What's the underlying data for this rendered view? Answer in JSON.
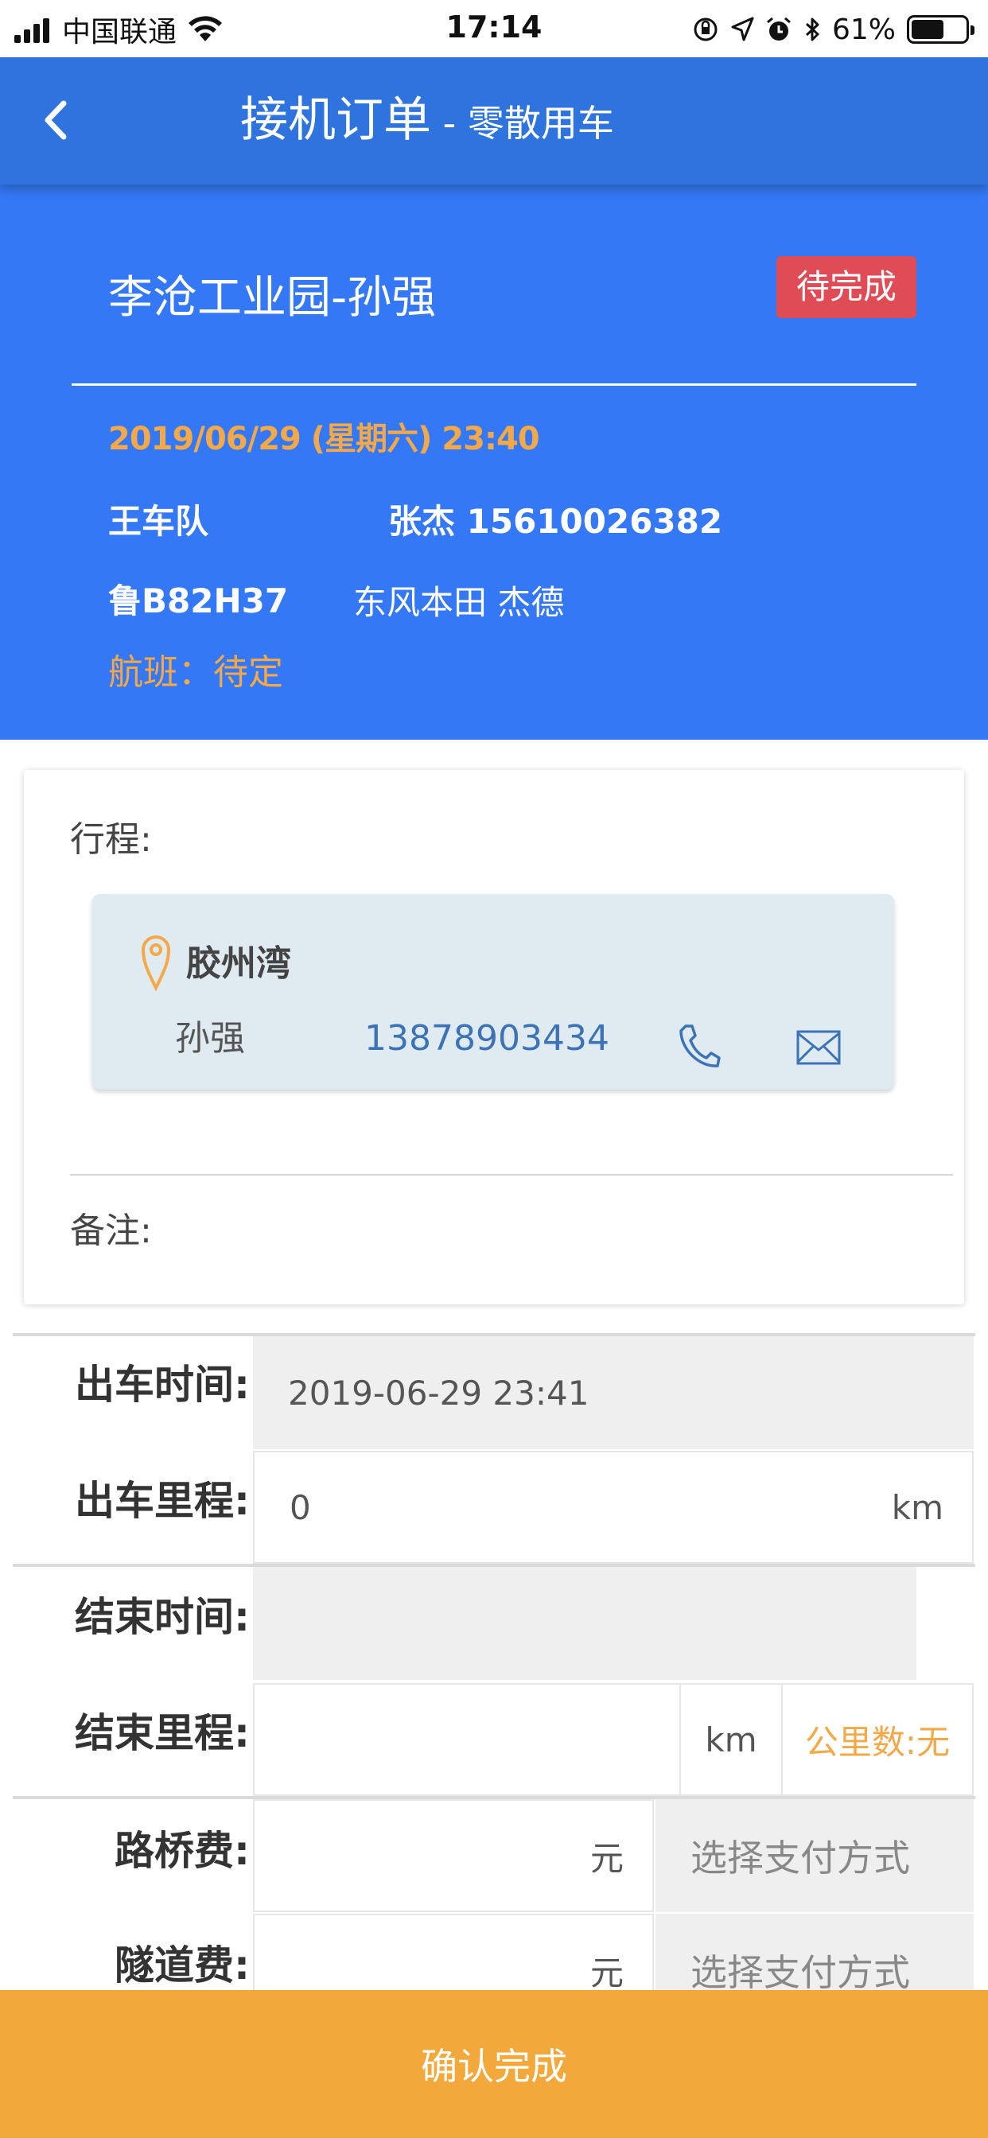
{
  "status_bar": {
    "carrier": "中国联通",
    "time": "17:14",
    "battery_pct": "61%",
    "battery_level": 0.61
  },
  "nav": {
    "title": "接机订单",
    "subtitle": " - 零散用车"
  },
  "header": {
    "name": "李沧工业园-孙强",
    "badge": "待完成",
    "datetime": "2019/06/29 (星期六) 23:40",
    "team": "王车队",
    "driver": "张杰 15610026382",
    "plate": "鲁B82H37",
    "car_model": "东风本田 杰德",
    "flight": "航班：待定"
  },
  "trip": {
    "label": "行程:",
    "place": "胶州湾",
    "passenger_name": "孙强",
    "passenger_phone": "13878903434",
    "note_label": "备注:"
  },
  "form": {
    "depart_time_label": "出车时间:",
    "depart_time_value": "2019-06-29 23:41",
    "depart_mileage_label": "出车里程:",
    "depart_mileage_value": "0",
    "depart_mileage_unit": "km",
    "end_time_label": "结束时间:",
    "end_time_value": "",
    "end_mileage_label": "结束里程:",
    "end_mileage_unit": "km",
    "distance_text": "公里数:无",
    "toll_label": "路桥费:",
    "toll_unit": "元",
    "toll_pay": "选择支付方式",
    "tunnel_label": "隧道费:",
    "tunnel_unit": "元",
    "tunnel_pay": "选择支付方式"
  },
  "confirm_button": "确认完成",
  "colors": {
    "nav_blue": "#2f73de",
    "header_blue": "#3478f6",
    "badge_red": "#e04c55",
    "accent_orange": "#f3a84a",
    "button_orange": "#f3a83c",
    "phone_blue": "#3c73b6"
  }
}
